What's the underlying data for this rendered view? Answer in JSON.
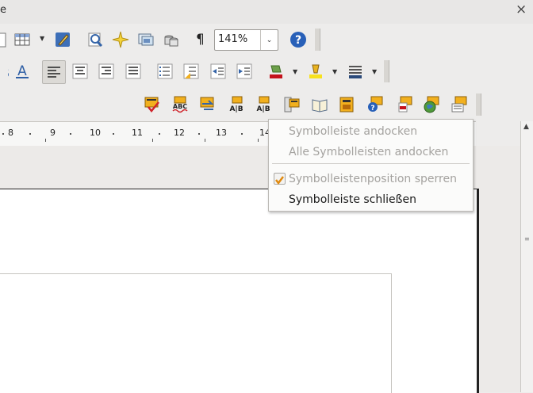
{
  "window": {
    "title_fragment": "e",
    "close_symbol": "×"
  },
  "toolbar1": {
    "pilcrow": "¶",
    "zoom_value": "141%"
  },
  "ruler": {
    "labels": [
      "8",
      "9",
      "10",
      "11",
      "12",
      "13",
      "14"
    ]
  },
  "context_menu": {
    "items": [
      {
        "label": "Symbolleiste andocken",
        "enabled": false
      },
      {
        "label": "Alle Symbolleisten andocken",
        "enabled": false
      },
      {
        "label": "Symbolleistenposition sperren",
        "enabled": false,
        "checked": true
      },
      {
        "label": "Symbolleiste schließen",
        "enabled": true
      }
    ]
  },
  "colors": {
    "highlight_yellow": "#f7e11d",
    "font_color_red": "#c4121b",
    "help_blue": "#2860b8",
    "icon_orange": "#f2b01e"
  },
  "icons": {
    "toolbar1": [
      "table-icon",
      "table-dropdown-icon",
      "draw-functions-icon",
      "find-replace-icon",
      "navigator-icon",
      "gallery-icon",
      "data-sources-icon",
      "formatting-marks-icon",
      "zoom-dropdown-icon",
      "help-icon"
    ],
    "toolbar2": [
      "shadow-icon",
      "font-color-icon",
      "align-left-icon",
      "align-center-icon",
      "align-right-icon",
      "justify-icon",
      "numbering-icon",
      "bullets-icon",
      "decrease-indent-icon",
      "increase-indent-icon",
      "font-color-icon",
      "highlight-icon",
      "background-color-icon"
    ],
    "toolbar3": [
      "spellcheck-icon",
      "autospellcheck-icon",
      "autocorrect-icon",
      "hyphenation-icon",
      "thesaurus-icon",
      "word-count-icon",
      "book-preview-icon",
      "glossary-icon",
      "help-tip-icon",
      "pdf-export-icon",
      "globe-icon",
      "note-icon"
    ]
  }
}
